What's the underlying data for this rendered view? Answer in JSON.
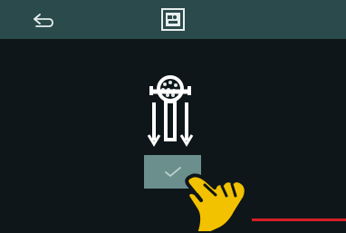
{
  "header": {
    "back_icon": "back-arrow-icon",
    "program_icon": "tool-program-icon"
  },
  "main": {
    "illustration_icon": "tool-removal-icon",
    "confirm_icon": "checkmark-icon",
    "gesture_icon": "tap-hand-icon"
  },
  "colors": {
    "topbar": "#2b4a4b",
    "background": "#0f1619",
    "button": "#6b8f8c",
    "accent_line": "#d51f26",
    "hand": "#f2c200"
  }
}
